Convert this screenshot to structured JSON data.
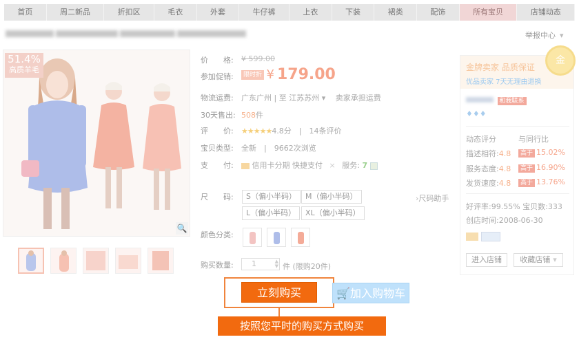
{
  "nav": {
    "items": [
      {
        "label": "首页",
        "active": false
      },
      {
        "label": "周二新品",
        "active": false
      },
      {
        "label": "折扣区",
        "active": false
      },
      {
        "label": "毛衣",
        "active": false
      },
      {
        "label": "外套",
        "active": false
      },
      {
        "label": "牛仔裤",
        "active": false
      },
      {
        "label": "上衣",
        "active": false
      },
      {
        "label": "下装",
        "active": false
      },
      {
        "label": "裙类",
        "active": false
      },
      {
        "label": "配饰",
        "active": false
      },
      {
        "label": "所有宝贝",
        "active": true
      },
      {
        "label": "店铺动态",
        "active": false
      }
    ]
  },
  "header": {
    "report": "举报中心",
    "report_caret": "▾"
  },
  "gallery": {
    "badge_pct": "51.4%",
    "badge_text": "高质羊毛",
    "zoom_icon": "🔍"
  },
  "product": {
    "price_label": "价　　格:",
    "price_value": "¥ 599.00",
    "promo_label": "参加促销:",
    "promo_tag": "限时折",
    "promo_currency": "¥",
    "promo_price": "179.00",
    "shipping_label": "物流运费:",
    "shipping_from": "广东广州",
    "shipping_to_prefix": "至",
    "shipping_to": "江苏苏州",
    "shipping_note": "卖家承担运费",
    "sold_label": "30天售出:",
    "sold_count": "508",
    "sold_unit": "件",
    "rating_label": "评　　价:",
    "rating_stars": "★★★★★",
    "rating_score": "4.8分",
    "rating_count": "14条评价",
    "type_label": "宝贝类型:",
    "type_value": "全新",
    "views": "9662次浏览",
    "pay_label": "支　　付:",
    "pay_credit": "信用卡分期",
    "pay_quick": "快捷支付",
    "service_label": "服务:",
    "size_label": "尺　　码:",
    "sizes": [
      "S（偏小半码）",
      "M（偏小半码）",
      "L（偏小半码）",
      "XL（偏小半码）"
    ],
    "size_helper": "尺码助手",
    "color_label": "颜色分类:",
    "qty_label": "购买数量:",
    "qty_value": "1",
    "qty_unit": "件 (限购20件)",
    "buy_now": "立刻购买",
    "add_cart": "加入购物车",
    "tip": "按照您平时的购买方式购买"
  },
  "shop": {
    "title": "金牌卖家 品质保证",
    "subtitle": "优品卖家 7天无理由退换",
    "medal": "金",
    "contact": "和我联系",
    "dsr_title": "动态评分",
    "dsr_compare": "与同行比",
    "dsr": [
      {
        "name": "描述相符:",
        "score": "4.8",
        "tag": "高于",
        "pct": "15.02%"
      },
      {
        "name": "服务态度:",
        "score": "4.8",
        "tag": "高于",
        "pct": "16.90%"
      },
      {
        "name": "发货速度:",
        "score": "4.8",
        "tag": "高于",
        "pct": "13.76%"
      }
    ],
    "good_rate": "好评率:99.55%",
    "items_count": "宝贝数:333",
    "created": "创店时间:2008-06-30",
    "enter_shop": "进入店铺",
    "fav_shop": "收藏店铺"
  }
}
